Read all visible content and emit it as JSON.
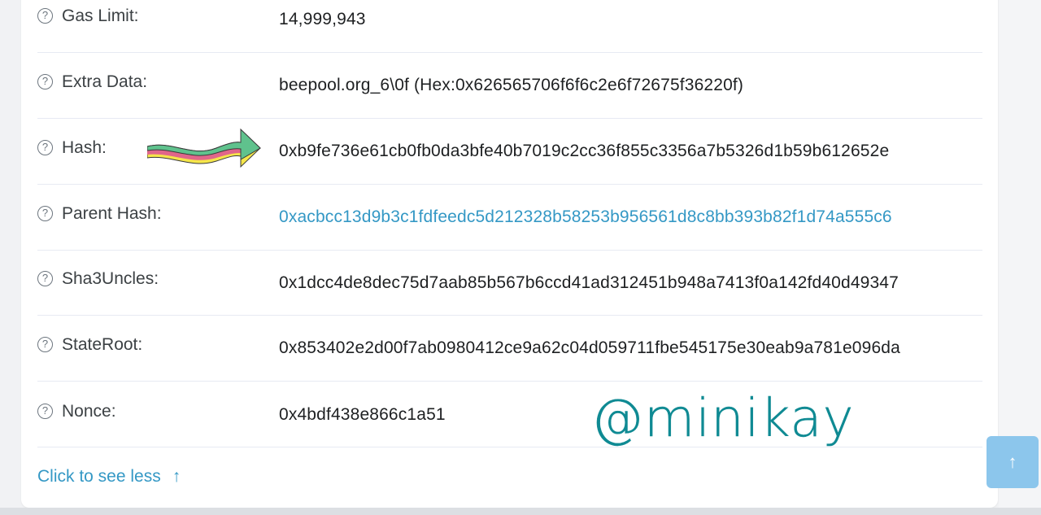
{
  "details": {
    "rows": [
      {
        "label": "Gas Limit:",
        "value": "14,999,943"
      },
      {
        "label": "Extra Data:",
        "value": "beepool.org_6\\0f (Hex:0x626565706f6f6c2e6f72675f36220f)"
      },
      {
        "label": "Hash:",
        "value": "0xb9fe736e61cb0fb0da3bfe40b7019c2cc36f855c3356a7b5326d1b59b612652e"
      },
      {
        "label": "Parent Hash:",
        "value": "0xacbcc13d9b3c1fdfeedc5d212328b58253b956561d8c8bb393b82f1d74a555c6"
      },
      {
        "label": "Sha3Uncles:",
        "value": "0x1dcc4de8dec75d7aab85b567b6ccd41ad312451b948a7413f0a142fd40d49347"
      },
      {
        "label": "StateRoot:",
        "value": "0x853402e2d00f7ab0980412ce9a62c04d059711fbe545175e30eab9a781e096da"
      },
      {
        "label": "Nonce:",
        "value": "0x4bdf438e866c1a51"
      }
    ],
    "help_icon_glyph": "?"
  },
  "footer": {
    "see_less_label": "Click to see less",
    "see_less_arrow": "↑"
  },
  "scroll_top": {
    "glyph": "↑"
  },
  "watermark": {
    "text": "@minikay"
  },
  "colors": {
    "link": "#3498c5",
    "watermark": "#0f8a93",
    "scroll_top_bg": "#8cc6ec"
  }
}
